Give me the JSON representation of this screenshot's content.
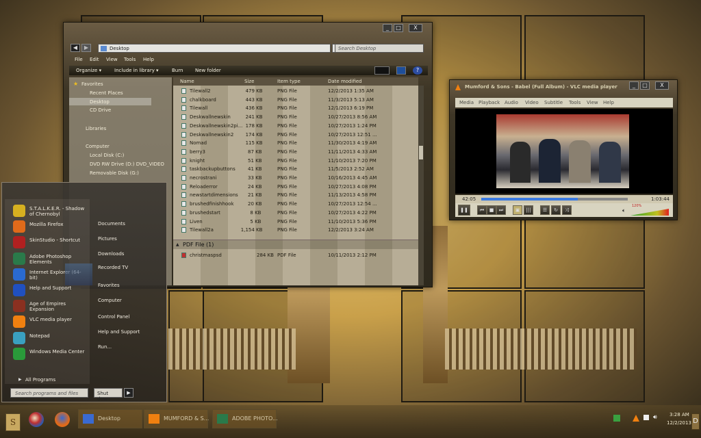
{
  "explorer": {
    "address": "Desktop",
    "search_placeholder": "Search Desktop",
    "menu": [
      "File",
      "Edit",
      "View",
      "Tools",
      "Help"
    ],
    "toolbar": [
      "Organize ▾",
      "Include in library ▾",
      "Burn",
      "New folder"
    ],
    "close_label": "X",
    "nav": {
      "favorites": "Favorites",
      "recent": "Recent Places",
      "desktop": "Desktop",
      "cd": "CD Drive",
      "libraries": "Libraries",
      "computer": "Computer",
      "local": "Local Disk (C:)",
      "dvd": "DVD RW Drive (D:) DVD_VIDEO",
      "removable": "Removable Disk (G:)"
    },
    "columns": {
      "name": "Name",
      "size": "Size",
      "type": "Item type",
      "date": "Date modified"
    },
    "rows": [
      [
        "Tilewall2",
        "479 KB",
        "PNG File",
        "12/2/2013 1:35 AM"
      ],
      [
        "chalkboard",
        "443 KB",
        "PNG File",
        "11/3/2013 5:13 AM"
      ],
      [
        "Tilewall",
        "436 KB",
        "PNG File",
        "12/1/2013 6:19 PM"
      ],
      [
        "Deskwallnewskin",
        "241 KB",
        "PNG File",
        "10/27/2013 8:56 AM"
      ],
      [
        "Deskwallnewskin2pi...",
        "178 KB",
        "PNG File",
        "10/27/2013 1:24 PM"
      ],
      [
        "Deskwallnewskin2",
        "174 KB",
        "PNG File",
        "10/27/2013 12:51 ..."
      ],
      [
        "Nomad",
        "115 KB",
        "PNG File",
        "11/30/2013 4:19 AM"
      ],
      [
        "berry3",
        "87 KB",
        "PNG File",
        "11/11/2013 4:33 AM"
      ],
      [
        "knight",
        "51 KB",
        "PNG File",
        "11/10/2013 7:20 PM"
      ],
      [
        "taskbackupbuttons",
        "41 KB",
        "PNG File",
        "11/5/2013 2:52 AM"
      ],
      [
        "necrostrani",
        "33 KB",
        "PNG File",
        "10/16/2013 4:45 AM"
      ],
      [
        "Reloaderror",
        "24 KB",
        "PNG File",
        "10/27/2013 4:08 PM"
      ],
      [
        "newstartdimensions",
        "21 KB",
        "PNG File",
        "11/13/2013 4:58 PM"
      ],
      [
        "brushedfinishhook",
        "20 KB",
        "PNG File",
        "10/27/2013 12:54 ..."
      ],
      [
        "brushedstart",
        "8 KB",
        "PNG File",
        "10/27/2013 4:22 PM"
      ],
      [
        "Liven",
        "5 KB",
        "PNG File",
        "11/10/2013 5:36 PM"
      ],
      [
        "Tilewall2a",
        "1,154 KB",
        "PNG File",
        "12/2/2013 3:24 AM"
      ]
    ],
    "pdf_group": "PDF File (1)",
    "pdf_row": [
      "christmaspsd",
      "284 KB",
      "PDF File",
      "10/11/2013 2:12 PM"
    ]
  },
  "vlc": {
    "title": "Mumford & Sons - Babel (Full Album) - VLC media player",
    "menu": [
      "Media",
      "Playback",
      "Audio",
      "Video",
      "Subtitle",
      "Tools",
      "View",
      "Help"
    ],
    "elapsed": "42:05",
    "total": "1:03:44",
    "progress": 0.66,
    "volume": "120%",
    "close_label": "X"
  },
  "startmenu": {
    "pinned": [
      {
        "label": "S.T.A.L.K.E.R. - Shadow of Chernobyl",
        "color": "#d6b020"
      },
      {
        "label": "Mozilla Firefox",
        "color": "#e06a1a"
      },
      {
        "label": "SkinStudio - Shortcut",
        "color": "#b02020"
      },
      {
        "label": "Adobe Photoshop Elements",
        "color": "#2a7a4a"
      },
      {
        "label": "Internet Explorer (64-bit)",
        "color": "#2a6ad0"
      },
      {
        "label": "Help and Support",
        "color": "#2050c0"
      },
      {
        "label": "Age of Empires Expansion",
        "color": "#8a3020"
      },
      {
        "label": "VLC media player",
        "color": "#f08010"
      },
      {
        "label": "Notepad",
        "color": "#3aa0c0"
      },
      {
        "label": "Windows Media Center",
        "color": "#2a9a3a"
      }
    ],
    "all_programs": "All Programs",
    "search_placeholder": "Search programs and files",
    "shutdown": "Shut down",
    "right_links": [
      "Documents",
      "Pictures",
      "Downloads",
      "Recorded TV",
      "Favorites",
      "Computer",
      "Control Panel",
      "Help and Support",
      "Run..."
    ]
  },
  "taskbar": {
    "tasks": [
      "Desktop",
      "MUMFORD & S...",
      "ADOBE PHOTO..."
    ],
    "time": "3:28 AM",
    "date": "12/2/2013"
  }
}
